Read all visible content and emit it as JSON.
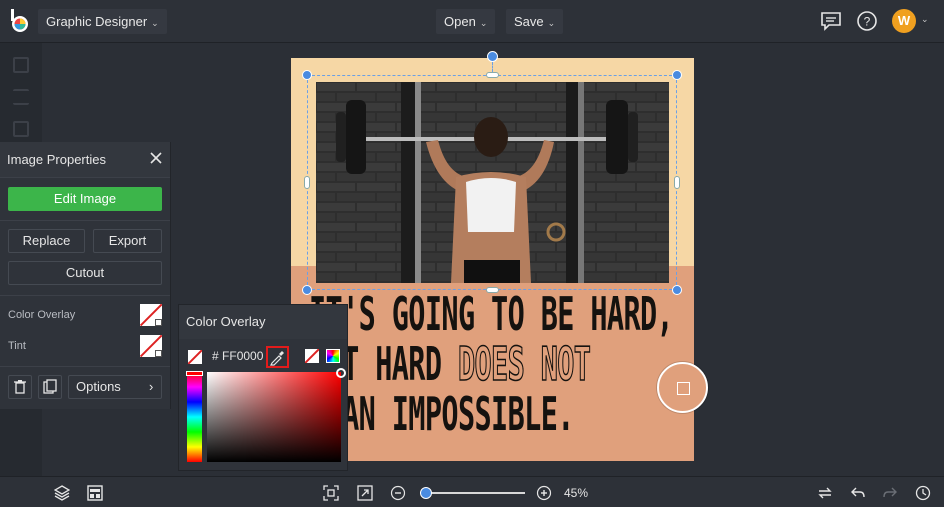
{
  "topbar": {
    "app_name": "Graphic Designer",
    "open_label": "Open",
    "save_label": "Save",
    "avatar_initial": "W",
    "icons": [
      "logo-icon",
      "chat-icon",
      "help-icon",
      "chevron-down-icon"
    ]
  },
  "design": {
    "quote_line1": "IT'S GOING TO BE HARD,",
    "quote_line2a": "BUT HARD ",
    "quote_line2b": "DOES NOT",
    "quote_line3": "MEAN IMPOSSIBLE.",
    "colors": {
      "top_band": "#f6d7a5",
      "bottom_band": "#e0a07c",
      "text": "#15120f",
      "selection": "#4a8be0"
    }
  },
  "image_properties": {
    "title": "Image Properties",
    "edit_image": "Edit Image",
    "replace": "Replace",
    "export": "Export",
    "cutout": "Cutout",
    "color_overlay_label": "Color Overlay",
    "tint_label": "Tint",
    "options_label": "Options",
    "accent": "#3cb54a"
  },
  "color_overlay": {
    "title": "Color Overlay",
    "hex_prefix": "#",
    "hex_value": "FF0000",
    "selected_color": "#ff0000"
  },
  "bottombar": {
    "zoom_level": "45%",
    "zoom_fraction": 0.05
  }
}
